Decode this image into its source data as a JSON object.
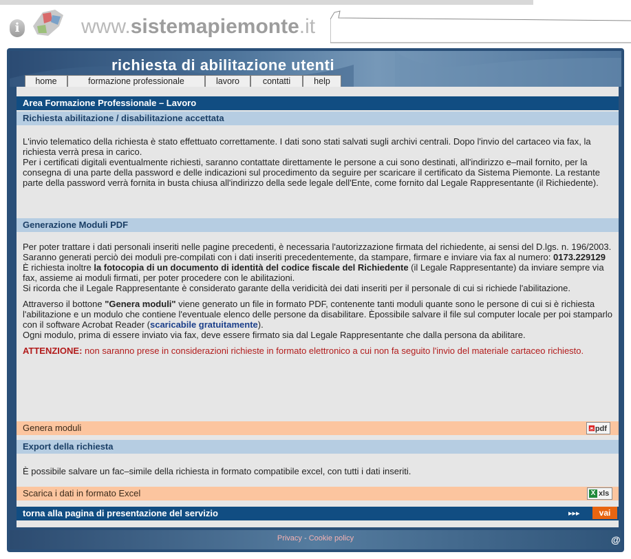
{
  "header": {
    "site_prefix": "www.",
    "site_name": "sistemapiemonte",
    "site_suffix": ".it",
    "info_icon": "i",
    "banner_title": "richiesta di abilitazione utenti"
  },
  "nav": {
    "tabs": [
      {
        "label": "home"
      },
      {
        "label": "formazione professionale"
      },
      {
        "label": "lavoro"
      },
      {
        "label": "contatti"
      },
      {
        "label": "help"
      }
    ]
  },
  "sections": {
    "area_title": "Area Formazione Professionale – Lavoro",
    "request_title": "Richiesta abilitazione / disabilitazione accettata",
    "request_p1": "L'invio telematico della richiesta è stato effettuato correttamente. I dati sono stati salvati sugli archivi centrali. Dopo l'invio del cartaceo via fax, la richiesta verrà presa in carico.",
    "request_p2": "Per i certificati digitali eventualmente richiesti, saranno contattate direttamente le persone a cui sono destinati, all'indirizzo e–mail fornito, per la consegna di una parte della password e delle indicazioni sul procedimento da seguire per scaricare il certificato da Sistema Piemonte. La restante parte della password verrà fornita in busta chiusa all'indirizzo della sede legale dell'Ente, come fornito dal Legale Rappresentante (il Richiedente).",
    "pdf_title": "Generazione Moduli PDF",
    "pdf_p1": "Per poter trattare i dati personali inseriti nelle pagine precedenti, è necessaria l'autorizzazione firmata del richiedente, ai sensi del D.lgs. n. 196/2003. Saranno generati perciò dei moduli pre-compilati con i dati inseriti precedentemente, da stampare, firmare e inviare via fax al numero:",
    "fax_number": "0173.229129",
    "pdf_p2_a": "È richiesta inoltre ",
    "pdf_p2_b": "la fotocopia di un documento di identità del codice fiscale del Richiedente",
    "pdf_p2_c": " (il Legale Rappresentante) da inviare sempre via fax, assieme ai moduli firmati, per poter procedere con le abilitazioni.",
    "pdf_p3": "Si ricorda che il Legale Rappresentante è considerato garante della veridicità dei dati inseriti per il personale di cui si richiede l'abilitazione.",
    "pdf_p4_a": "Attraverso il bottone ",
    "pdf_p4_b": "\"Genera moduli\"",
    "pdf_p4_c": " viene generato un file in formato PDF, contenente tanti moduli quante sono le persone di cui si è richiesta l'abilitazione e un modulo che contiene l'eventuale elenco delle persone da disabilitare. Èpossibile salvare il file sul computer locale per poi stamparlo con il software Acrobat Reader (",
    "pdf_p4_link": "scaricabile gratuitamente",
    "pdf_p4_d": ").",
    "pdf_p5": "Ogni modulo, prima di essere inviato via fax, deve essere firmato sia dal Legale Rappresentante che dalla persona da abilitare.",
    "attention_label": "ATTENZIONE:",
    "attention_text": " non saranno prese in considerazioni richieste in formato elettronico a cui non fa seguito l'invio del materiale cartaceo richiesto.",
    "genera_label": "Genera moduli",
    "pdf_button": "pdf",
    "export_title": "Export della richiesta",
    "export_text": "È possibile salvare un fac–simile della richiesta in formato compatibile excel, con tutti i dati inseriti.",
    "excel_label": "Scarica i dati in formato Excel",
    "xls_button": "xls",
    "back_label": "torna alla pagina di presentazione del servizio",
    "arrows": "▸▸▸",
    "vai_button": "vai"
  },
  "footer": {
    "privacy": "Privacy",
    "separator": " - ",
    "cookie": "Cookie policy",
    "at": "@"
  },
  "colors": {
    "dark_bar": "#114d82",
    "light_bar": "#b6cde2",
    "orange_bar": "#fcc59f",
    "vai": "#e86511",
    "attention": "#b21b1b"
  }
}
